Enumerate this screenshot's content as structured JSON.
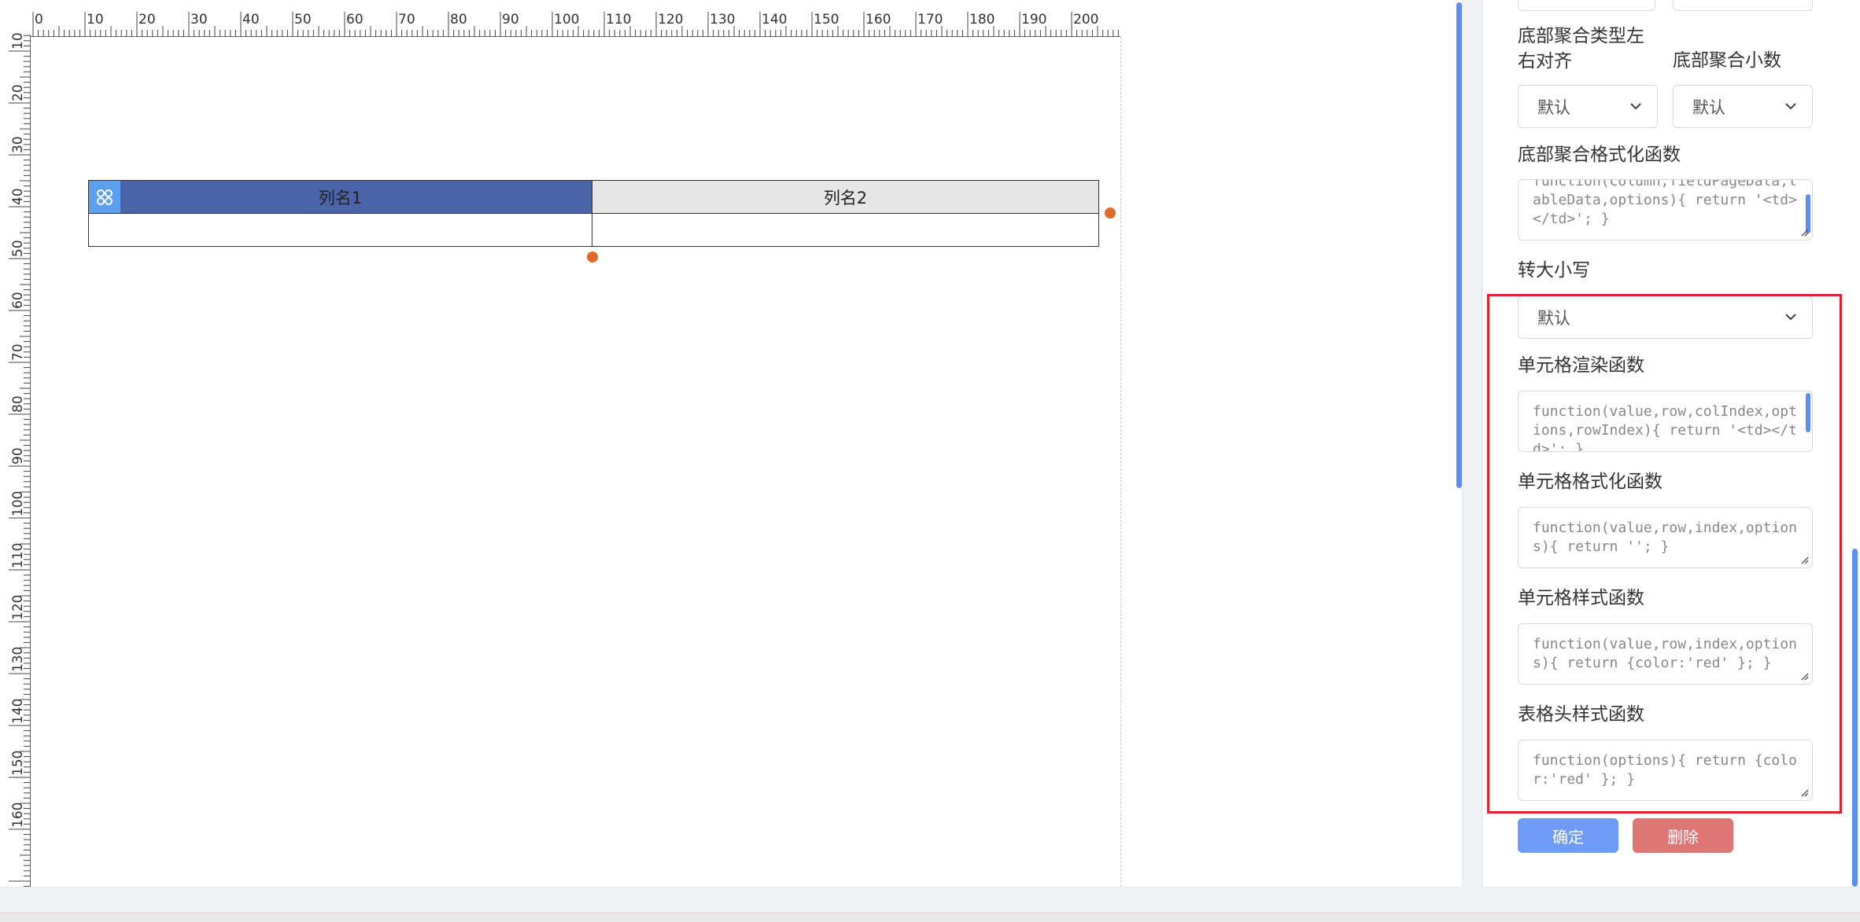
{
  "ruler": {
    "top_ticks": [
      "0",
      "10",
      "20",
      "30",
      "40",
      "50",
      "60",
      "70",
      "80",
      "90",
      "100",
      "110",
      "120",
      "130",
      "140",
      "150",
      "160",
      "170",
      "180",
      "190",
      "200"
    ],
    "left_ticks": [
      "10",
      "20",
      "30",
      "40",
      "50",
      "60",
      "70",
      "80",
      "90",
      "100",
      "110",
      "120",
      "130",
      "140",
      "150",
      "160"
    ]
  },
  "table": {
    "headers": [
      "列名1",
      "列名2"
    ],
    "body_row": [
      "",
      ""
    ]
  },
  "panel": {
    "fields": {
      "footer_agg_align_label": "底部聚合类型左右对齐",
      "footer_agg_align_value": "默认",
      "footer_agg_decimal_label": "底部聚合小数",
      "footer_agg_decimal_value": "默认",
      "footer_agg_format_label": "底部聚合格式化函数",
      "footer_agg_format_value": "function(column,fieldPageData,tableData,options){ return '<td></td>'; }",
      "case_label": "转大小写",
      "case_value": "默认",
      "cell_render_label": "单元格渲染函数",
      "cell_render_value": "function(value,row,colIndex,options,rowIndex){ return '<td></td>'; }",
      "cell_format_label": "单元格格式化函数",
      "cell_format_value": "function(value,row,index,options){ return ''; }",
      "cell_style_label": "单元格样式函数",
      "cell_style_value": "function(value,row,index,options){ return {color:'red' }; }",
      "header_style_label": "表格头样式函数",
      "header_style_value": "function(options){ return {color:'red' }; }"
    },
    "buttons": {
      "confirm": "确定",
      "delete": "删除"
    }
  },
  "colors": {
    "accent": "#5b8ff2",
    "header_col1": "#4b63a9",
    "header_col2": "#e6e6e6",
    "handle_dot": "#e06a2a",
    "confirm_btn": "#6d9bf5",
    "delete_btn": "#df7676",
    "highlight": "#d9232f"
  },
  "icons": {
    "table_handle": "grid-icon",
    "select_arrow": "chevron-down-icon"
  }
}
